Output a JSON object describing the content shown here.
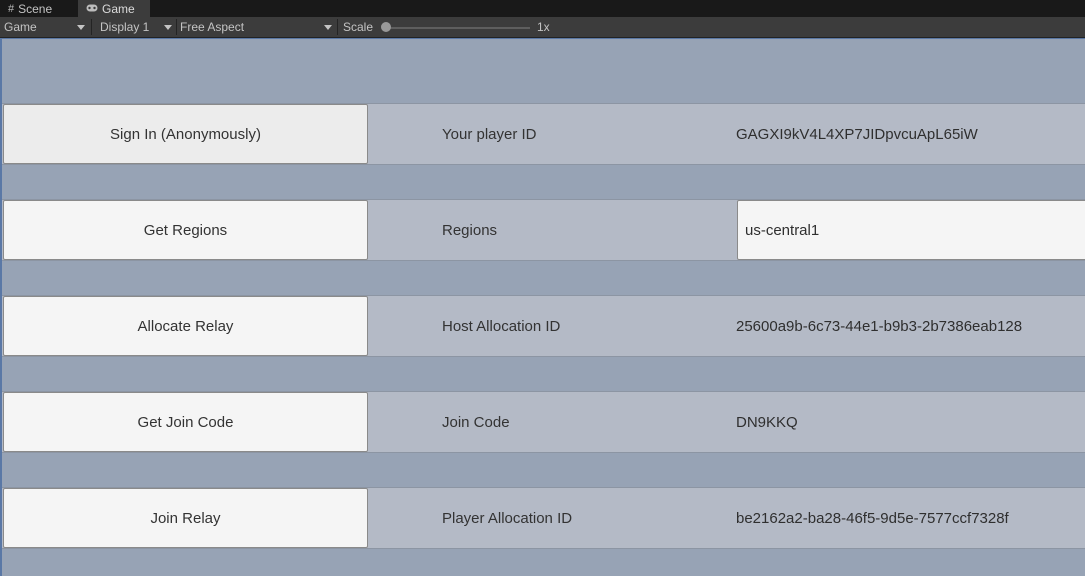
{
  "tabs": [
    {
      "label": "Scene",
      "icon": "grid-icon"
    },
    {
      "label": "Game",
      "icon": "gamepad-icon"
    }
  ],
  "toolbar": {
    "mode": "Game",
    "display": "Display 1",
    "aspect": "Free Aspect",
    "scale_label": "Scale",
    "scale_value": "1x"
  },
  "rows": [
    {
      "button": "Sign In (Anonymously)",
      "label": "Your player ID",
      "value": "GAGXI9kV4L4XP7JIDpvcuApL65iW"
    },
    {
      "button": "Get Regions",
      "label": "Regions",
      "value": "us-central1"
    },
    {
      "button": "Allocate Relay",
      "label": "Host Allocation ID",
      "value": "25600a9b-6c73-44e1-b9b3-2b7386eab128"
    },
    {
      "button": "Get Join Code",
      "label": "Join Code",
      "value": "DN9KKQ"
    },
    {
      "button": "Join Relay",
      "label": "Player Allocation ID",
      "value": "be2162a2-ba28-46f5-9d5e-7577ccf7328f"
    }
  ]
}
